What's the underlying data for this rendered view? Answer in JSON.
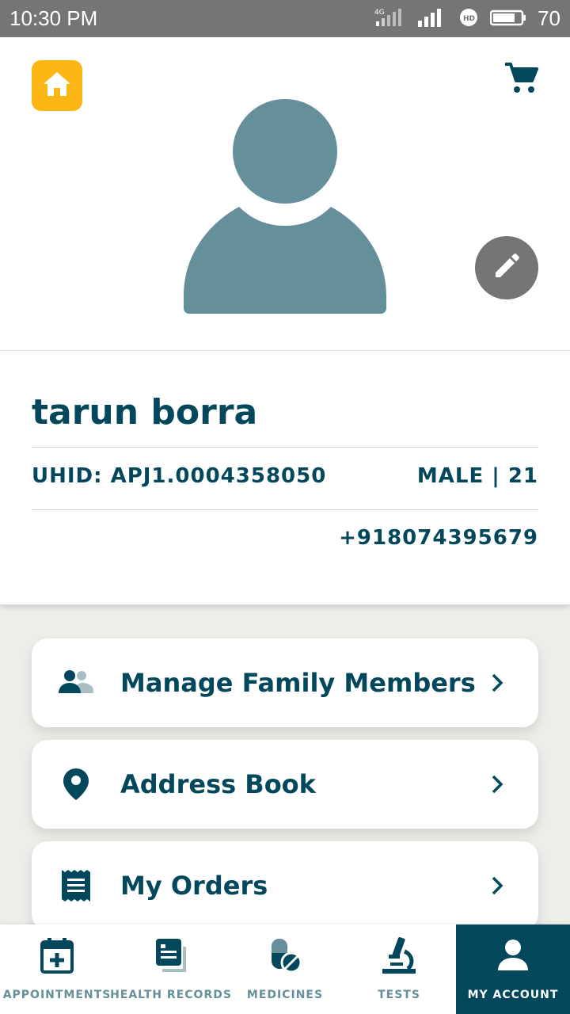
{
  "status_bar": {
    "time": "10:30 PM",
    "network_label": "4G",
    "battery": "70"
  },
  "header": {
    "home_icon": "home-icon",
    "cart_icon": "cart-icon",
    "edit_icon": "pencil-icon"
  },
  "profile": {
    "name": "tarun borra",
    "uhid": "UHID: APJ1.0004358050",
    "gender_age": "MALE | 21",
    "phone": "+918074395679"
  },
  "menu": {
    "items": [
      {
        "label": "Manage Family Members",
        "icon": "family-icon"
      },
      {
        "label": "Address Book",
        "icon": "location-pin-icon"
      },
      {
        "label": "My Orders",
        "icon": "receipt-icon"
      }
    ]
  },
  "bottom_nav": {
    "items": [
      {
        "label": "APPOINTMENTS",
        "icon": "calendar-plus-icon"
      },
      {
        "label": "HEALTH RECORDS",
        "icon": "records-icon"
      },
      {
        "label": "MEDICINES",
        "icon": "pills-icon"
      },
      {
        "label": "TESTS",
        "icon": "microscope-icon"
      },
      {
        "label": "MY ACCOUNT",
        "icon": "user-icon"
      }
    ],
    "active": "MY ACCOUNT"
  },
  "colors": {
    "primary": "#02475b",
    "accent": "#fcb716",
    "avatar": "#658f9b",
    "muted": "#757575"
  }
}
